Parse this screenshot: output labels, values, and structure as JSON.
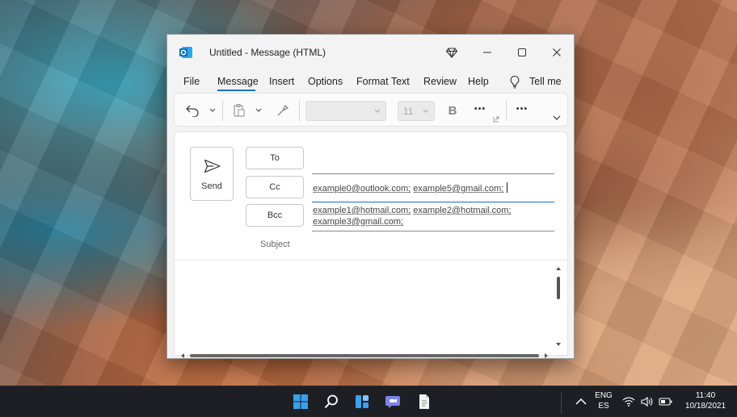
{
  "window": {
    "title": "Untitled  -  Message (HTML)"
  },
  "menu": {
    "items": [
      "File",
      "Message",
      "Insert",
      "Options",
      "Format Text",
      "Review",
      "Help"
    ],
    "tell_me": "Tell me",
    "active": "Message"
  },
  "ribbon": {
    "font_size": "11",
    "bold_label": "B",
    "more_label": "•••"
  },
  "compose": {
    "send_label": "Send",
    "to_label": "To",
    "cc_label": "Cc",
    "bcc_label": "Bcc",
    "subject_label": "Subject",
    "to_value": "",
    "cc_addresses": [
      "example0@outlook.com;",
      "example5@gmail.com;"
    ],
    "bcc_addresses_line1": [
      "example1@hotmail.com;",
      "example2@hotmail.com;"
    ],
    "bcc_addresses_line2": [
      "example3@gmail.com;"
    ]
  },
  "taskbar": {
    "language_top": "ENG",
    "language_bottom": "ES",
    "time": "11:40",
    "date": "10/18/2021"
  },
  "colors": {
    "accent": "#1b6ec2",
    "outlook_blue": "#0f6cbd",
    "taskbar_bg": "#1d1f24"
  },
  "icons": {
    "app": "outlook-icon",
    "premium": "diamond-icon",
    "undo": "undo-icon",
    "paste": "clipboard-icon",
    "format_painter": "paintbrush-icon",
    "send": "send-icon",
    "lightbulb": "lightbulb-icon"
  }
}
